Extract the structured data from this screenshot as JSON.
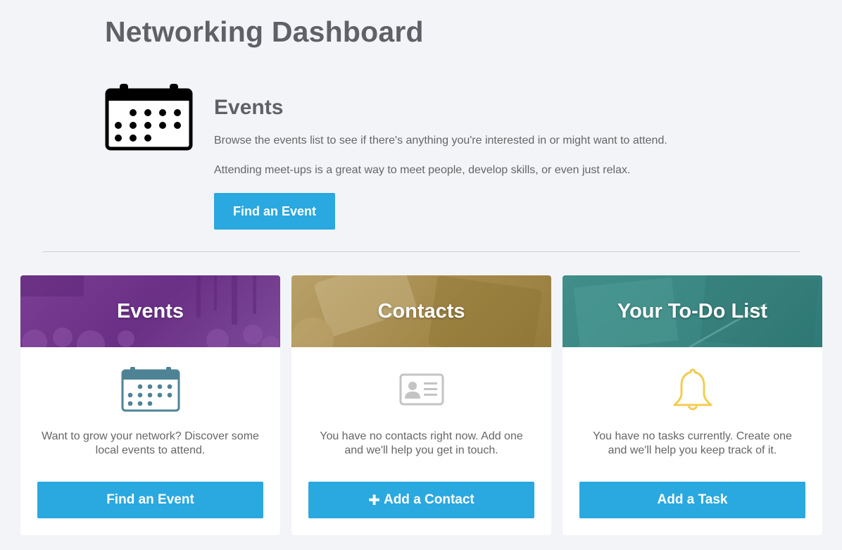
{
  "page": {
    "title": "Networking Dashboard"
  },
  "hero": {
    "title": "Events",
    "text1": "Browse the events list to see if there's anything you're interested in or might want to attend.",
    "text2": "Attending meet-ups is a great way to meet people, develop skills, or even just relax.",
    "button_label": "Find an Event",
    "icon": "calendar-icon"
  },
  "cards": [
    {
      "title": "Events",
      "icon": "calendar-icon",
      "icon_color": "#4e8396",
      "header_color": "#6f3389",
      "description": "Want to grow your network? Discover some local events to attend.",
      "button_label": "Find an Event"
    },
    {
      "title": "Contacts",
      "icon": "contact-card-icon",
      "icon_color": "#c4c4c4",
      "header_color": "#a68b4e",
      "description": "You have no contacts right now. Add one and we'll help you get in touch.",
      "button_label": "Add a Contact",
      "button_icon": "plus-icon"
    },
    {
      "title": "Your To-Do List",
      "icon": "bell-icon",
      "icon_color": "#f3cc50",
      "header_color": "#3b8783",
      "description": "You have no tasks currently. Create one and we'll help you keep track of it.",
      "button_label": "Add a Task"
    }
  ],
  "colors": {
    "accent": "#2aa8e0",
    "background": "#f3f4f8",
    "title": "#5f6166"
  }
}
